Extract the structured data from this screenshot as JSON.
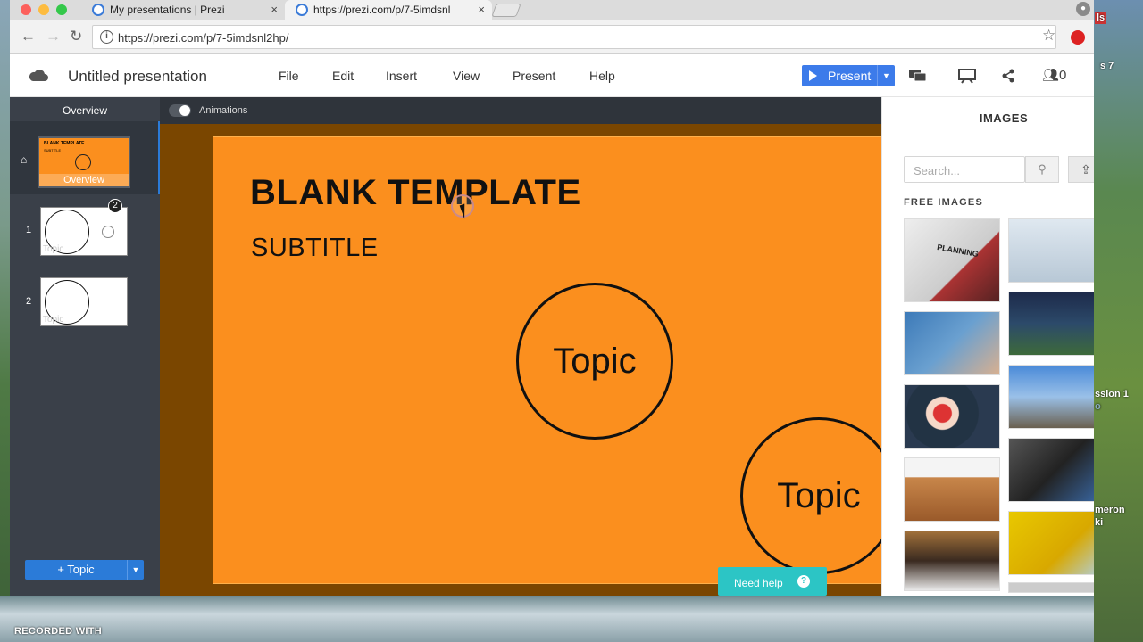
{
  "browser": {
    "tabs": [
      {
        "label": "My presentations | Prezi",
        "close": "×"
      },
      {
        "label": "https://prezi.com/p/7-5imdsnl",
        "close": "×"
      }
    ],
    "url": "https://prezi.com/p/7-5imdsnl2hp/"
  },
  "app": {
    "title": "Untitled presentation",
    "menu": [
      "File",
      "Edit",
      "Insert",
      "View",
      "Present",
      "Help"
    ],
    "present_label": "Present",
    "collaborators_count": "0",
    "accent": "#3c7bea"
  },
  "sidebar": {
    "overview_header": "Overview",
    "overview_caption": "Overview",
    "thumb_title": "BLANK TEMPLATE",
    "thumb_subtitle": "SUBTITLE",
    "thumb_topic": "Topic",
    "items": [
      {
        "number": "1",
        "caption": "Topic",
        "badge": "2"
      },
      {
        "number": "2",
        "caption": "Topic"
      }
    ],
    "add_topic_label": "+ Topic"
  },
  "canvas": {
    "animations_label": "Animations",
    "slide": {
      "title": "BLANK TEMPLATE",
      "subtitle": "SUBTITLE",
      "topics": [
        "Topic",
        "Topic"
      ],
      "background": "#fb8f1e"
    },
    "need_help_label": "Need help",
    "need_help_icon": "?"
  },
  "images_panel": {
    "title": "IMAGES",
    "search_placeholder": "Search...",
    "free_images_label": "FREE IMAGES",
    "first_image_text": "PLANNING"
  },
  "desktop": {
    "recorded_label": "RECORDED WITH",
    "side_texts": [
      "ls",
      "s 7",
      "ssion 1",
      "o",
      "meron",
      "ki"
    ]
  }
}
